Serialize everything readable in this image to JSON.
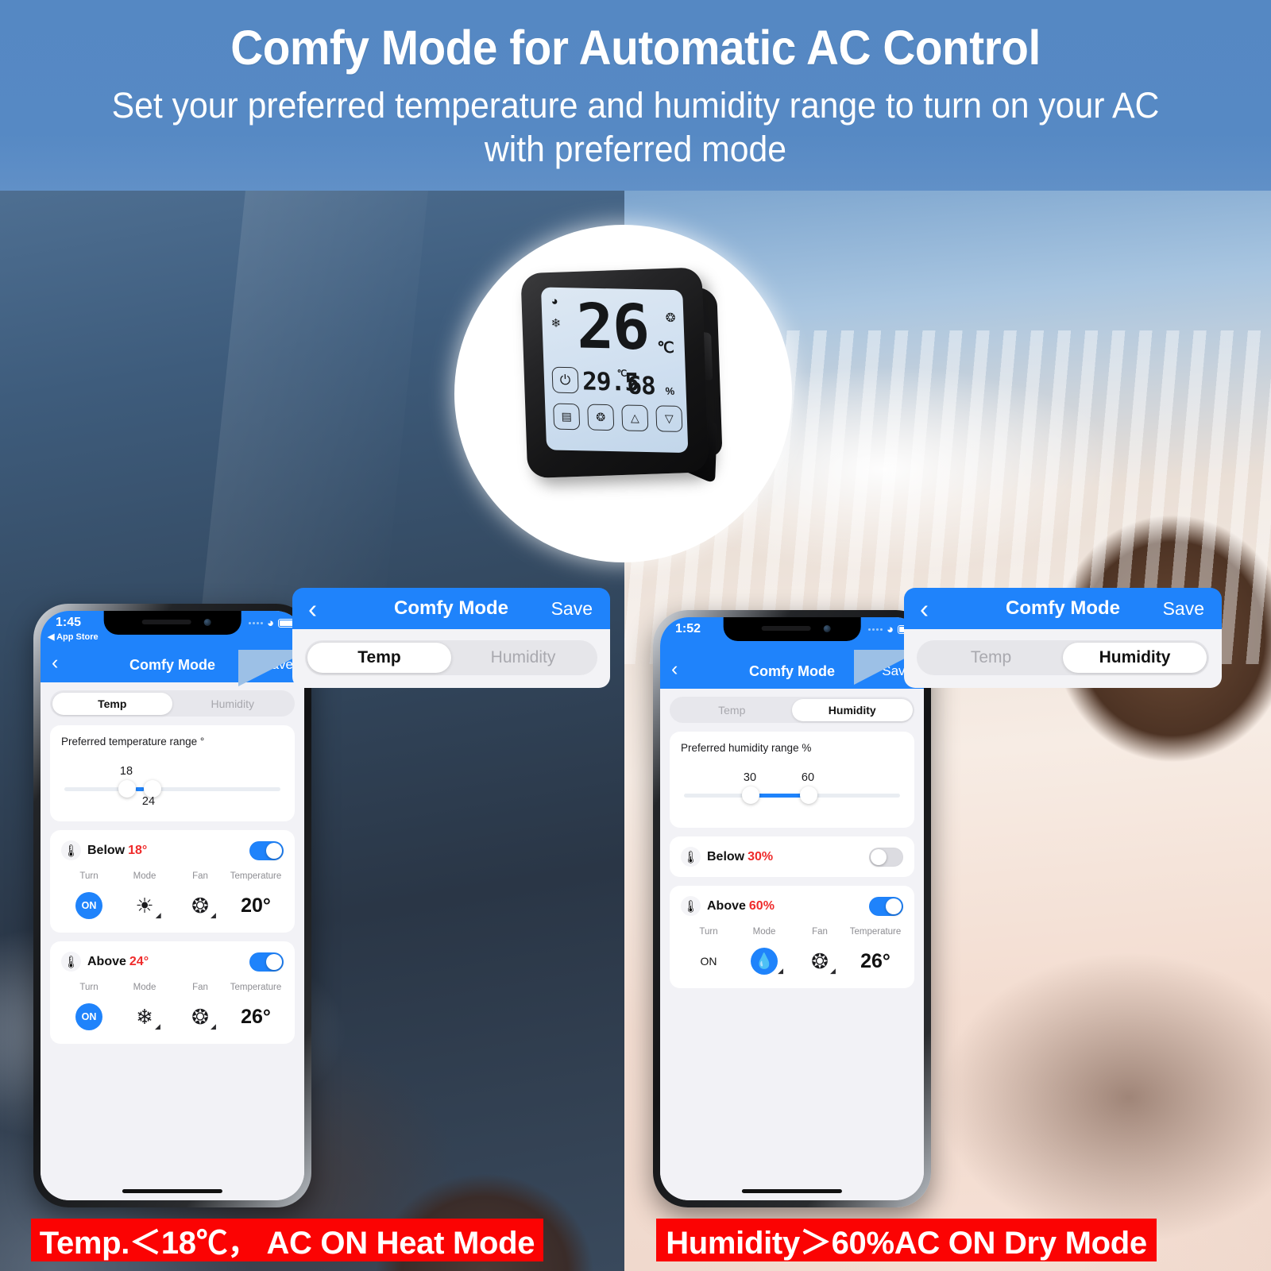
{
  "header": {
    "title": "Comfy Mode for Automatic AC Control",
    "subtitle": "Set your preferred temperature and humidity range to turn on your AC with preferred mode"
  },
  "device": {
    "wifi_icon": "wifi-icon",
    "snow_icon": "snowflake-icon",
    "fan_icon": "fan-icon",
    "set_temperature": "26",
    "set_unit": "℃",
    "current_temperature": "29.5",
    "current_temperature_unit": "℃",
    "humidity": "68",
    "humidity_unit": "%",
    "power_icon": "power-icon",
    "mode_icon": "mode-grid-icon",
    "fan_button_icon": "fan-icon",
    "up_icon": "arrow-up-icon",
    "down_icon": "arrow-down-icon"
  },
  "phone_left": {
    "status": {
      "time": "1:45",
      "app_back": "◀ App Store"
    },
    "nav": {
      "back": "‹",
      "title": "Comfy Mode",
      "save": "Save"
    },
    "tabs": [
      {
        "label": "Temp",
        "selected": true
      },
      {
        "label": "Humidity",
        "selected": false
      }
    ],
    "range_card": {
      "title": "Preferred temperature range °",
      "low_label": "18",
      "high_label": "24"
    },
    "rules": [
      {
        "condition": "Below",
        "value": "18°",
        "enabled": true,
        "columns": [
          "Turn",
          "Mode",
          "Fan",
          "Temperature"
        ],
        "turn": "ON",
        "mode_icon": "sun-heat-icon",
        "mode_glyph": "☀",
        "fan_icon": "fan-icon",
        "temperature": "20°"
      },
      {
        "condition": "Above",
        "value": "24°",
        "enabled": true,
        "columns": [
          "Turn",
          "Mode",
          "Fan",
          "Temperature"
        ],
        "turn": "ON",
        "mode_icon": "snowflake-cool-icon",
        "mode_glyph": "❄",
        "fan_icon": "fan-icon",
        "temperature": "26°"
      }
    ]
  },
  "phone_right": {
    "status": {
      "time": "1:52",
      "app_back": ""
    },
    "nav": {
      "back": "‹",
      "title": "Comfy Mode",
      "save": "Save"
    },
    "tabs": [
      {
        "label": "Temp",
        "selected": false
      },
      {
        "label": "Humidity",
        "selected": true
      }
    ],
    "range_card": {
      "title": "Preferred humidity range %",
      "low_label": "30",
      "high_label": "60"
    },
    "rules": [
      {
        "condition": "Below",
        "value": "30%",
        "enabled": false
      },
      {
        "condition": "Above",
        "value": "60%",
        "enabled": true,
        "columns": [
          "Turn",
          "Mode",
          "Fan",
          "Temperature"
        ],
        "turn": "ON",
        "mode_icon": "water-drop-dry-icon",
        "fan_icon": "fan-icon",
        "temperature": "26°"
      }
    ]
  },
  "callout_left": {
    "nav": {
      "back": "‹",
      "title": "Comfy Mode",
      "save": "Save"
    },
    "tabs": [
      {
        "label": "Temp",
        "selected": true
      },
      {
        "label": "Humidity",
        "selected": false
      }
    ]
  },
  "callout_right": {
    "nav": {
      "back": "‹",
      "title": "Comfy Mode",
      "save": "Save"
    },
    "tabs": [
      {
        "label": "Temp",
        "selected": false
      },
      {
        "label": "Humidity",
        "selected": true
      }
    ]
  },
  "banners": {
    "left": "Temp.＜18℃， AC ON Heat Mode",
    "right": "Humidity＞60%AC ON Dry Mode"
  },
  "colors": {
    "header_blue": "#5689c4",
    "ios_blue": "#1f83fb",
    "alert_red": "#fb0303",
    "value_red": "#ef2b2b"
  }
}
